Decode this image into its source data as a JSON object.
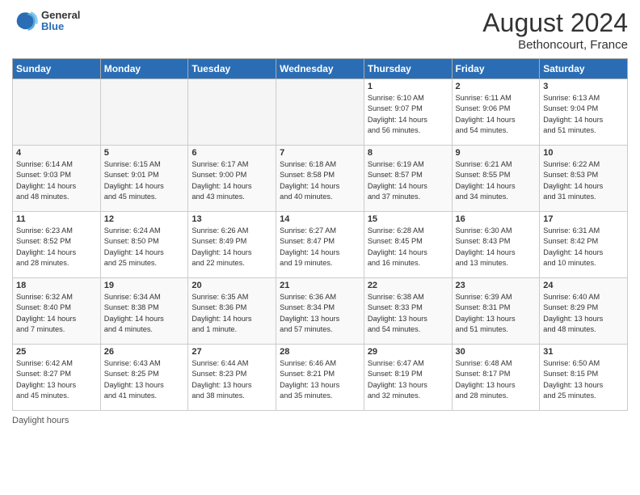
{
  "header": {
    "logo_general": "General",
    "logo_blue": "Blue",
    "month_year": "August 2024",
    "location": "Bethoncourt, France"
  },
  "days_of_week": [
    "Sunday",
    "Monday",
    "Tuesday",
    "Wednesday",
    "Thursday",
    "Friday",
    "Saturday"
  ],
  "weeks": [
    [
      {
        "day": "",
        "info": ""
      },
      {
        "day": "",
        "info": ""
      },
      {
        "day": "",
        "info": ""
      },
      {
        "day": "",
        "info": ""
      },
      {
        "day": "1",
        "info": "Sunrise: 6:10 AM\nSunset: 9:07 PM\nDaylight: 14 hours\nand 56 minutes."
      },
      {
        "day": "2",
        "info": "Sunrise: 6:11 AM\nSunset: 9:06 PM\nDaylight: 14 hours\nand 54 minutes."
      },
      {
        "day": "3",
        "info": "Sunrise: 6:13 AM\nSunset: 9:04 PM\nDaylight: 14 hours\nand 51 minutes."
      }
    ],
    [
      {
        "day": "4",
        "info": "Sunrise: 6:14 AM\nSunset: 9:03 PM\nDaylight: 14 hours\nand 48 minutes."
      },
      {
        "day": "5",
        "info": "Sunrise: 6:15 AM\nSunset: 9:01 PM\nDaylight: 14 hours\nand 45 minutes."
      },
      {
        "day": "6",
        "info": "Sunrise: 6:17 AM\nSunset: 9:00 PM\nDaylight: 14 hours\nand 43 minutes."
      },
      {
        "day": "7",
        "info": "Sunrise: 6:18 AM\nSunset: 8:58 PM\nDaylight: 14 hours\nand 40 minutes."
      },
      {
        "day": "8",
        "info": "Sunrise: 6:19 AM\nSunset: 8:57 PM\nDaylight: 14 hours\nand 37 minutes."
      },
      {
        "day": "9",
        "info": "Sunrise: 6:21 AM\nSunset: 8:55 PM\nDaylight: 14 hours\nand 34 minutes."
      },
      {
        "day": "10",
        "info": "Sunrise: 6:22 AM\nSunset: 8:53 PM\nDaylight: 14 hours\nand 31 minutes."
      }
    ],
    [
      {
        "day": "11",
        "info": "Sunrise: 6:23 AM\nSunset: 8:52 PM\nDaylight: 14 hours\nand 28 minutes."
      },
      {
        "day": "12",
        "info": "Sunrise: 6:24 AM\nSunset: 8:50 PM\nDaylight: 14 hours\nand 25 minutes."
      },
      {
        "day": "13",
        "info": "Sunrise: 6:26 AM\nSunset: 8:49 PM\nDaylight: 14 hours\nand 22 minutes."
      },
      {
        "day": "14",
        "info": "Sunrise: 6:27 AM\nSunset: 8:47 PM\nDaylight: 14 hours\nand 19 minutes."
      },
      {
        "day": "15",
        "info": "Sunrise: 6:28 AM\nSunset: 8:45 PM\nDaylight: 14 hours\nand 16 minutes."
      },
      {
        "day": "16",
        "info": "Sunrise: 6:30 AM\nSunset: 8:43 PM\nDaylight: 14 hours\nand 13 minutes."
      },
      {
        "day": "17",
        "info": "Sunrise: 6:31 AM\nSunset: 8:42 PM\nDaylight: 14 hours\nand 10 minutes."
      }
    ],
    [
      {
        "day": "18",
        "info": "Sunrise: 6:32 AM\nSunset: 8:40 PM\nDaylight: 14 hours\nand 7 minutes."
      },
      {
        "day": "19",
        "info": "Sunrise: 6:34 AM\nSunset: 8:38 PM\nDaylight: 14 hours\nand 4 minutes."
      },
      {
        "day": "20",
        "info": "Sunrise: 6:35 AM\nSunset: 8:36 PM\nDaylight: 14 hours\nand 1 minute."
      },
      {
        "day": "21",
        "info": "Sunrise: 6:36 AM\nSunset: 8:34 PM\nDaylight: 13 hours\nand 57 minutes."
      },
      {
        "day": "22",
        "info": "Sunrise: 6:38 AM\nSunset: 8:33 PM\nDaylight: 13 hours\nand 54 minutes."
      },
      {
        "day": "23",
        "info": "Sunrise: 6:39 AM\nSunset: 8:31 PM\nDaylight: 13 hours\nand 51 minutes."
      },
      {
        "day": "24",
        "info": "Sunrise: 6:40 AM\nSunset: 8:29 PM\nDaylight: 13 hours\nand 48 minutes."
      }
    ],
    [
      {
        "day": "25",
        "info": "Sunrise: 6:42 AM\nSunset: 8:27 PM\nDaylight: 13 hours\nand 45 minutes."
      },
      {
        "day": "26",
        "info": "Sunrise: 6:43 AM\nSunset: 8:25 PM\nDaylight: 13 hours\nand 41 minutes."
      },
      {
        "day": "27",
        "info": "Sunrise: 6:44 AM\nSunset: 8:23 PM\nDaylight: 13 hours\nand 38 minutes."
      },
      {
        "day": "28",
        "info": "Sunrise: 6:46 AM\nSunset: 8:21 PM\nDaylight: 13 hours\nand 35 minutes."
      },
      {
        "day": "29",
        "info": "Sunrise: 6:47 AM\nSunset: 8:19 PM\nDaylight: 13 hours\nand 32 minutes."
      },
      {
        "day": "30",
        "info": "Sunrise: 6:48 AM\nSunset: 8:17 PM\nDaylight: 13 hours\nand 28 minutes."
      },
      {
        "day": "31",
        "info": "Sunrise: 6:50 AM\nSunset: 8:15 PM\nDaylight: 13 hours\nand 25 minutes."
      }
    ]
  ],
  "footer": {
    "daylight_label": "Daylight hours"
  }
}
